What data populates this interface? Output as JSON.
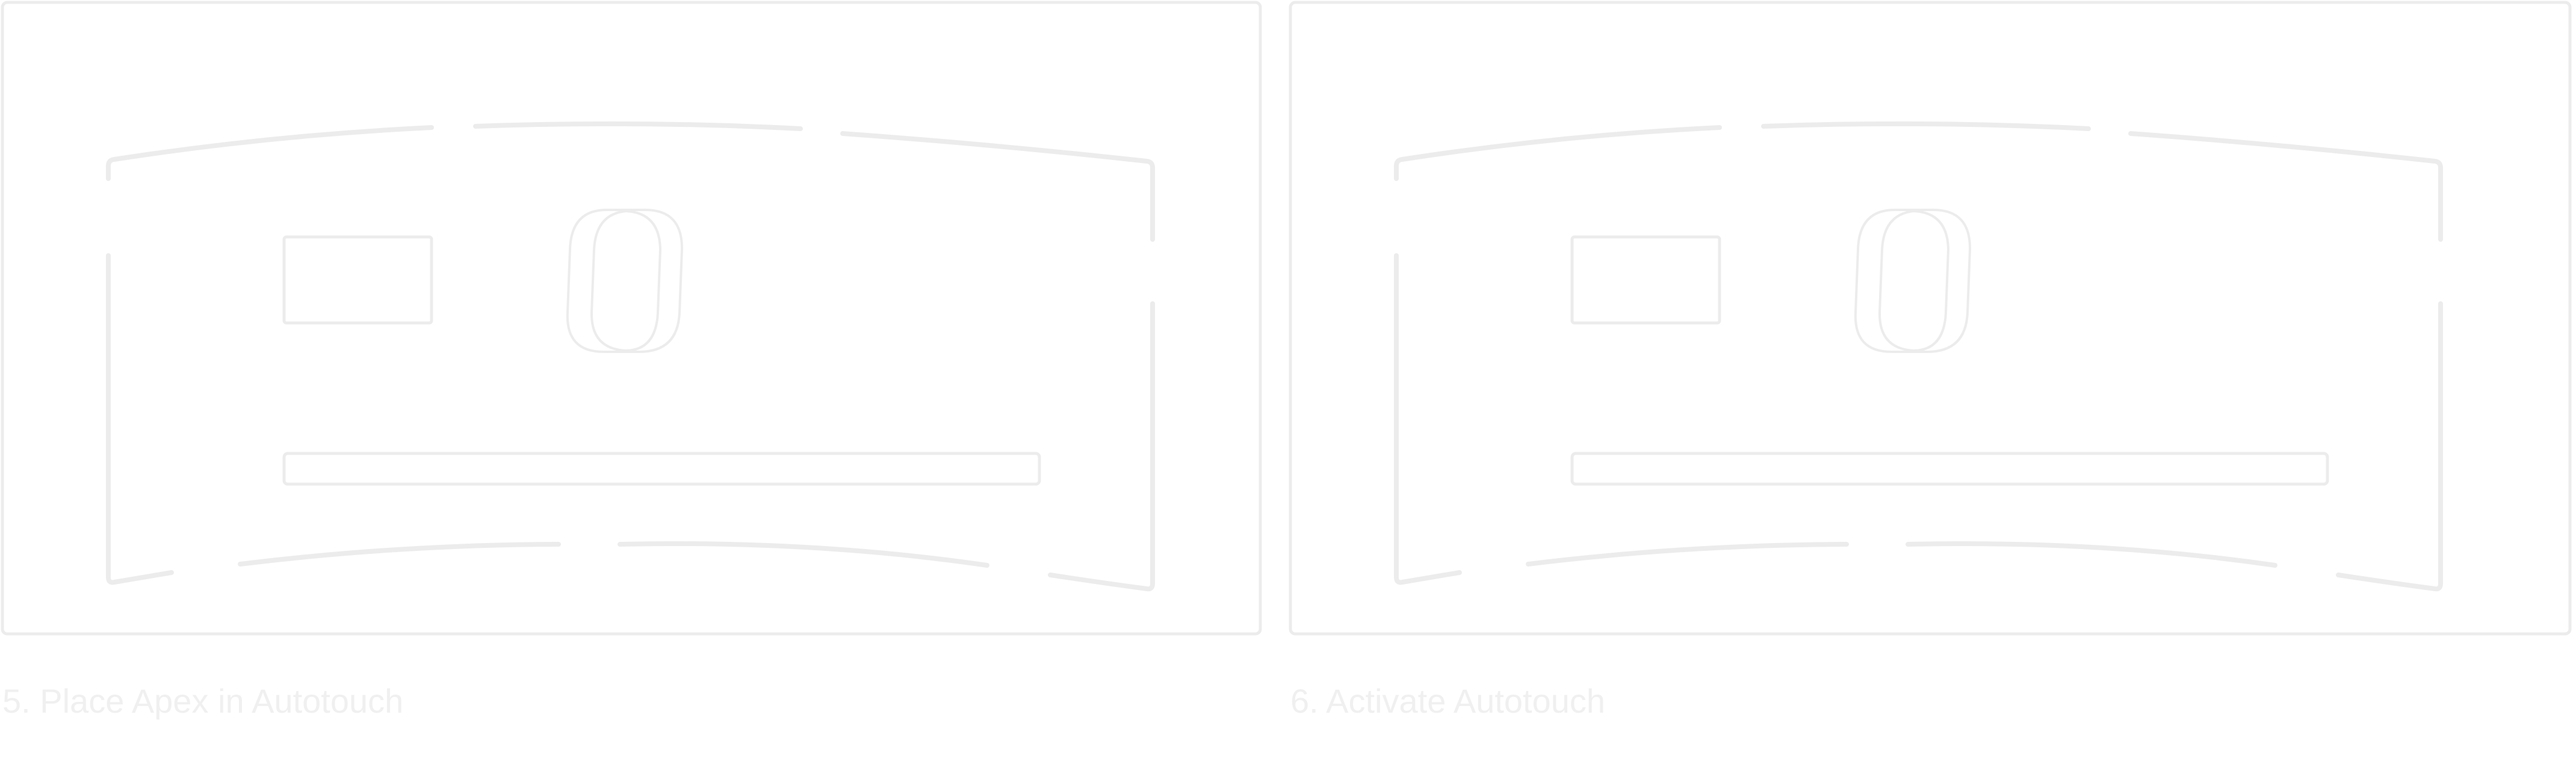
{
  "colors": {
    "stroke": "#ececec",
    "caption": "#f0f0f0",
    "background": "#ffffff"
  },
  "panels": [
    {
      "caption": "5. Place Apex in Autotouch",
      "icon": "apex-device-icon"
    },
    {
      "caption": "6. Activate Autotouch",
      "icon": "apex-device-icon"
    }
  ]
}
